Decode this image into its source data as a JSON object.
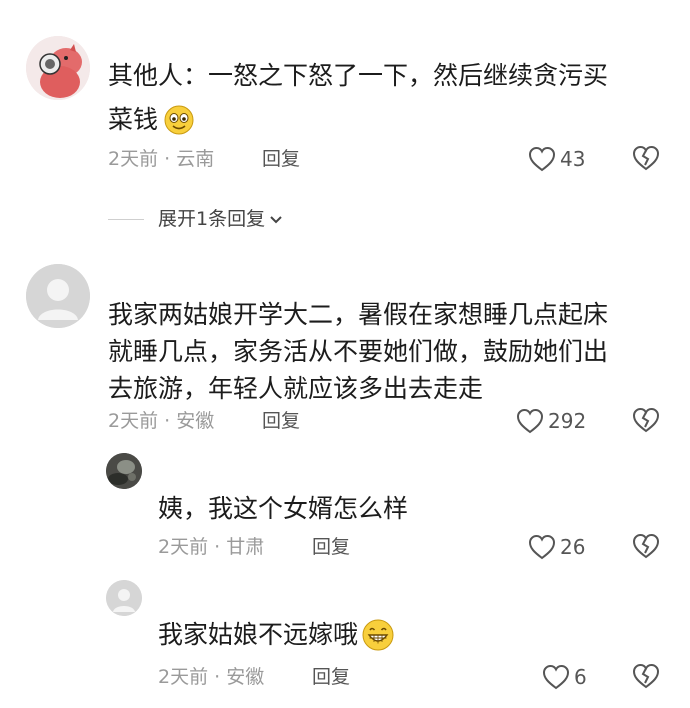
{
  "comments": [
    {
      "text": "其他人：一怒之下怒了一下，然后继续贪污买菜钱",
      "line1": "其他人：一怒之下怒了一下，然后继续贪污买",
      "line2": "菜钱",
      "meta": "2天前 · 云南",
      "reply_label": "回复",
      "likes": "43",
      "emoji": "grinning-face-icon"
    },
    {
      "line1": "我家两姑娘开学大二，暑假在家想睡几点起床",
      "line2": "就睡几点，家务活从不要她们做，鼓励她们出",
      "line3": "去旅游，年轻人就应该多出去走走",
      "meta": "2天前 · 安徽",
      "reply_label": "回复",
      "likes": "292"
    },
    {
      "text": "姨，我这个女婿怎么样",
      "meta": "2天前 · 甘肃",
      "reply_label": "回复",
      "likes": "26"
    },
    {
      "text": "我家姑娘不远嫁哦",
      "meta": "2天前 · 安徽",
      "reply_label": "回复",
      "likes": "6",
      "emoji": "grin-face-icon"
    }
  ],
  "expand_replies": {
    "label": "展开1条回复"
  },
  "colors": {
    "meta": "#9a9a9a",
    "text": "#1c1c1c",
    "avatar_gray": "#d6d6d6"
  }
}
